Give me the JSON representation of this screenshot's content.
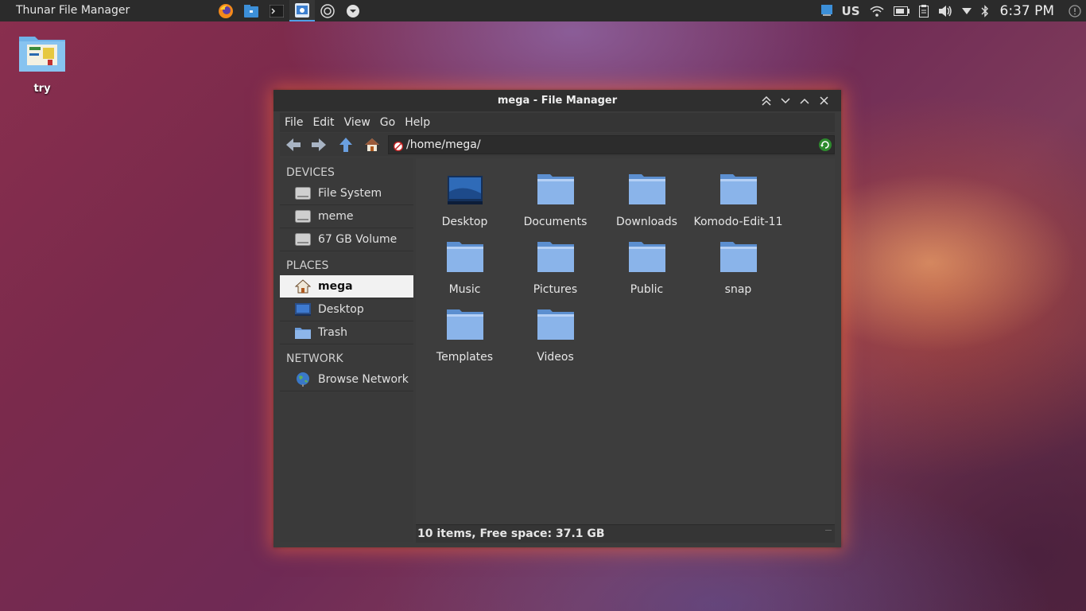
{
  "panel": {
    "app_title": "Thunar File Manager",
    "keyboard_layout": "US",
    "clock": "6:37 PM",
    "launchers": [
      "firefox-icon",
      "files-icon",
      "terminal-icon",
      "file-manager-icon",
      "settings-icon",
      "download-icon"
    ]
  },
  "desktop": {
    "icon_label": "try"
  },
  "window": {
    "title": "mega - File Manager",
    "menu": [
      "File",
      "Edit",
      "View",
      "Go",
      "Help"
    ],
    "location": "/home/mega/",
    "sidebar": {
      "devices_header": "DEVICES",
      "devices": [
        "File System",
        "meme",
        "67 GB Volume"
      ],
      "places_header": "PLACES",
      "places": [
        "mega",
        "Desktop",
        "Trash"
      ],
      "network_header": "NETWORK",
      "network": [
        "Browse Network"
      ]
    },
    "files": [
      "Desktop",
      "Documents",
      "Downloads",
      "Komodo-Edit-11",
      "Music",
      "Pictures",
      "Public",
      "snap",
      "Templates",
      "Videos"
    ],
    "status": "10 items, Free space: 37.1 GB"
  },
  "colors": {
    "panel_bg": "#2b2b2b",
    "window_bg": "#3b3b3b",
    "selected_bg": "#f2f2f2",
    "folder_blue": "#7fa8e0",
    "accent": "#4ea1e6"
  }
}
